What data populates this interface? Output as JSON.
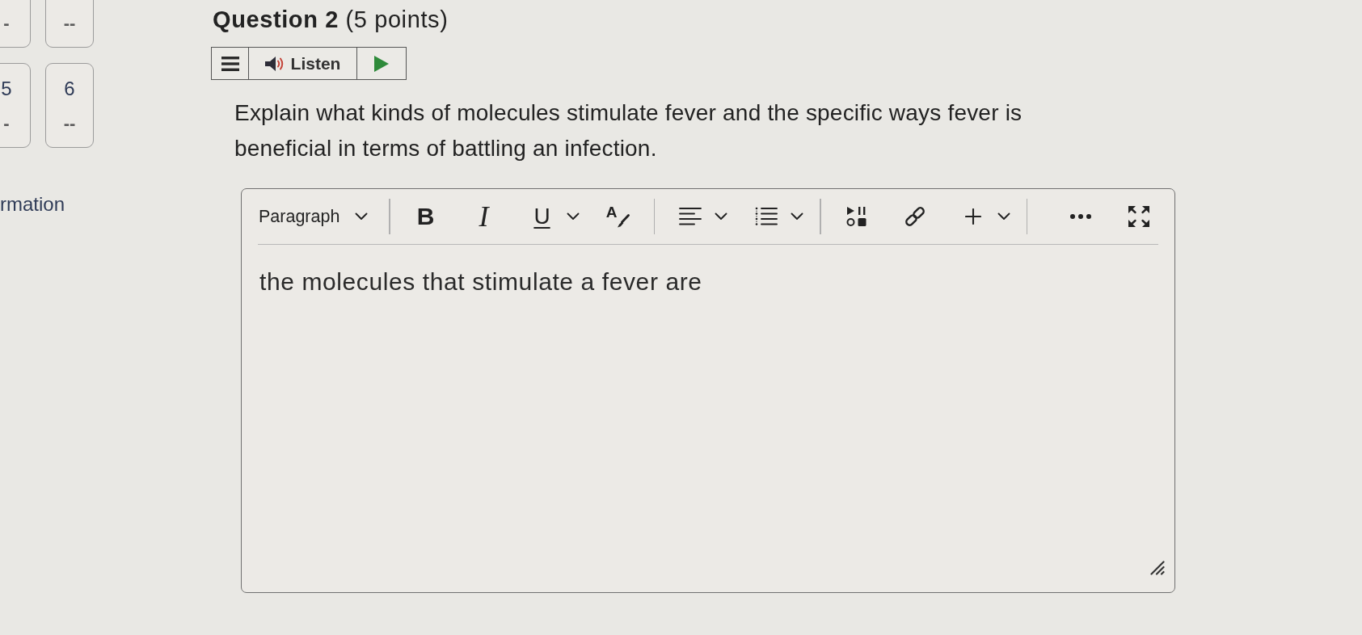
{
  "question_nav": {
    "tiles": [
      {
        "score": "-"
      },
      {
        "score": "--"
      },
      {
        "number": "5",
        "score": "-"
      },
      {
        "number": "6",
        "score": "--"
      }
    ]
  },
  "side_heading": "rmation",
  "question": {
    "title": "**Question 2** (5 points)",
    "listen_bar": {
      "label": "Listen"
    },
    "text": "Explain what kinds of molecules stimulate fever and the specific ways fever is beneficial in terms of battling an infection."
  },
  "editor": {
    "toolbar": {
      "block_format": "Paragraph",
      "groups": [
        [
          {
            "kind": "bold",
            "glyph": "B",
            "dropdown": false
          },
          {
            "kind": "italic",
            "glyph": "I",
            "dropdown": false
          },
          {
            "kind": "underline",
            "glyph": "U",
            "dropdown": true
          },
          {
            "kind": "text-style",
            "glyph": "A",
            "dropdown": false
          }
        ],
        [
          {
            "kind": "align",
            "dropdown": true
          },
          {
            "kind": "list",
            "dropdown": true
          }
        ],
        [
          {
            "kind": "media",
            "dropdown": false
          },
          {
            "kind": "link",
            "dropdown": false
          },
          {
            "kind": "insert",
            "dropdown": true
          }
        ],
        [
          {
            "kind": "more",
            "dropdown": false
          },
          {
            "kind": "fullscreen",
            "dropdown": false
          }
        ]
      ]
    },
    "value": "the molecules that stimulate a fever are"
  }
}
